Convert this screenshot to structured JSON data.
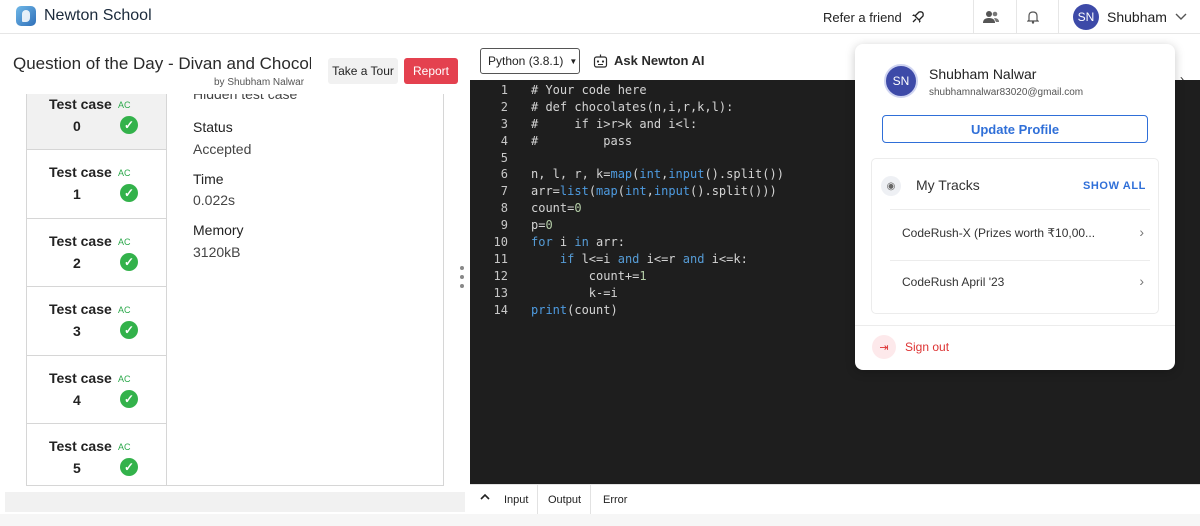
{
  "header": {
    "brand": "Newton School",
    "refer": "Refer a friend",
    "user_initials": "SN",
    "user_name": "Shubham"
  },
  "question": {
    "title": "Question of the Day - Divan and Chocola...",
    "author": "by Shubham Nalwar",
    "tour_label": "Take a Tour",
    "report_label": "Report"
  },
  "testcases": {
    "items": [
      {
        "label": "Test case",
        "number": "0",
        "status": "AC"
      },
      {
        "label": "Test case",
        "number": "1",
        "status": "AC"
      },
      {
        "label": "Test case",
        "number": "2",
        "status": "AC"
      },
      {
        "label": "Test case",
        "number": "3",
        "status": "AC"
      },
      {
        "label": "Test case",
        "number": "4",
        "status": "AC"
      },
      {
        "label": "Test case",
        "number": "5",
        "status": "AC"
      }
    ],
    "details": {
      "hidden": "Hidden test case",
      "status_label": "Status",
      "status_value": "Accepted",
      "time_label": "Time",
      "time_value": "0.022s",
      "memory_label": "Memory",
      "memory_value": "3120kB"
    }
  },
  "editor": {
    "language": "Python (3.8.1)",
    "ask_ai": "Ask Newton AI",
    "lines": [
      "# Your code here",
      "# def chocolates(n,i,r,k,l):",
      "#     if i>r>k and i<l:",
      "#         pass",
      "",
      "n, l, r, k=map(int,input().split())",
      "arr=list(map(int,input().split()))",
      "count=0",
      "p=0",
      "for i in arr:",
      "    if l<=i and i<=r and i<=k:",
      "        count+=1",
      "        k-=i",
      "print(count)"
    ]
  },
  "io_tabs": [
    "Input",
    "Output",
    "Error"
  ],
  "dropdown": {
    "initials": "SN",
    "name": "Shubham Nalwar",
    "email": "shubhamnalwar83020@gmail.com",
    "update_label": "Update Profile",
    "tracks_title": "My Tracks",
    "show_all": "SHOW ALL",
    "tracks": [
      {
        "name": "CodeRush-X (Prizes worth ₹10,00..."
      },
      {
        "name": "CodeRush April '23"
      }
    ],
    "signout": "Sign out"
  },
  "colors": {
    "accent": "#2f6fd8",
    "report": "#e4414f",
    "success": "#33b24b",
    "editor_bg": "#1e1e1e",
    "avatar": "#3d4aa8"
  }
}
